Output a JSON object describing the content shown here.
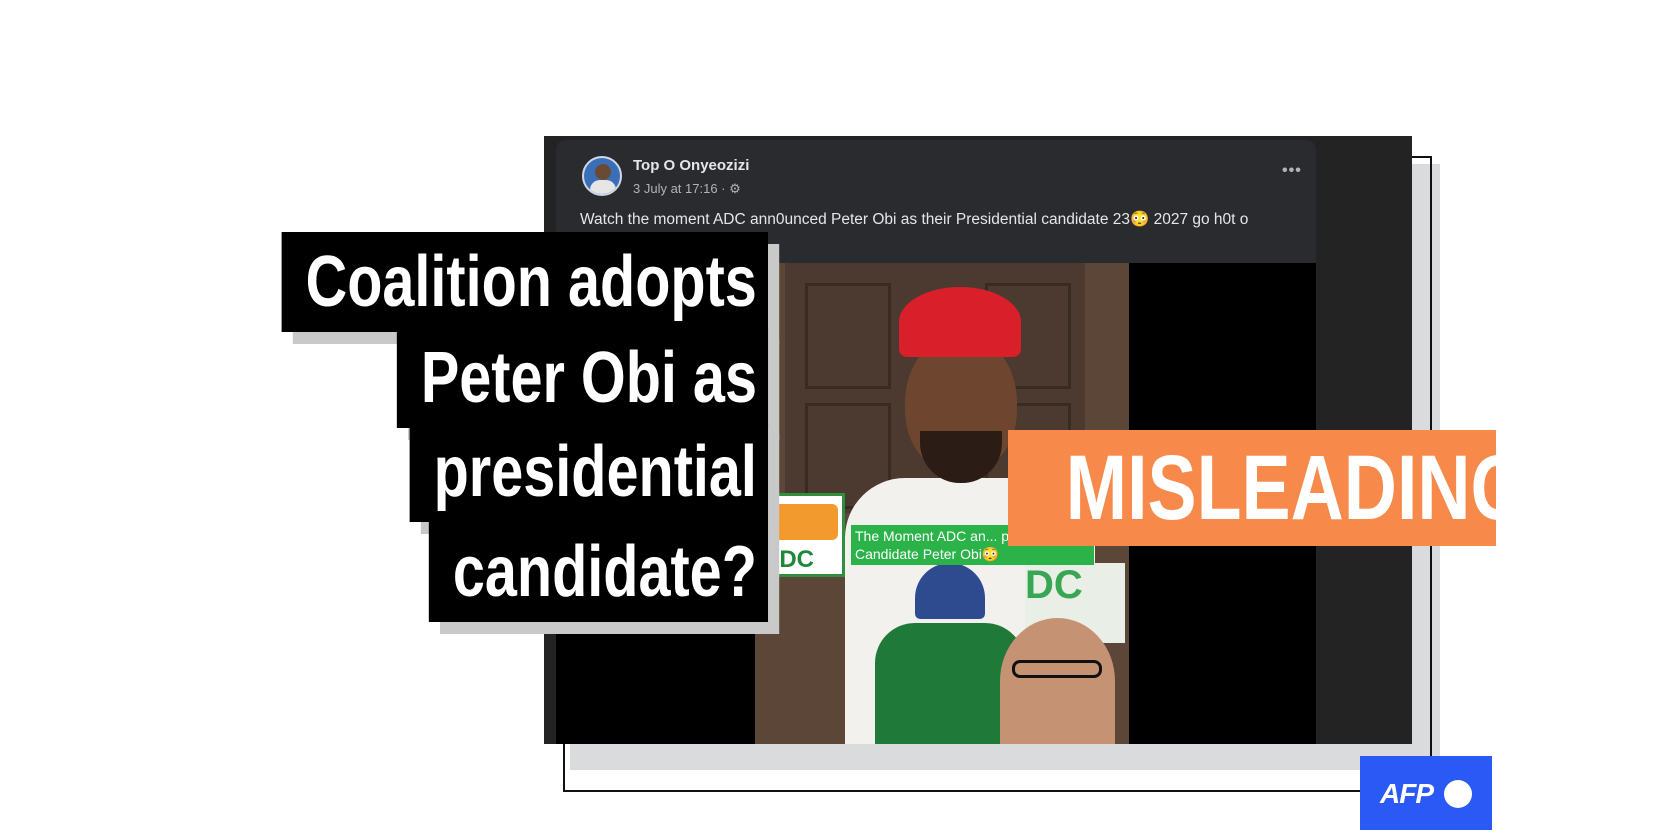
{
  "post": {
    "author": "Top O Onyeozizi",
    "timestamp": "3 July at 17:16 · ⚙",
    "more": "•••",
    "caption": "Watch the moment ADC ann0unced Peter Obi as their Presidential candidate 23😳  2027 go h0t o",
    "video_banner": "The Moment ADC an... presidential Candidate Peter Obi😳",
    "logo_text": "ADC",
    "backdrop_text": "DC"
  },
  "headline": {
    "lines": [
      "Coalition adopts",
      "Peter Obi as",
      "presidential",
      "candidate?"
    ]
  },
  "verdict": "MISLEADING",
  "brand": {
    "logo_text": "AFP",
    "color": "#2b59f5"
  },
  "colors": {
    "verdict": "#f7894a",
    "headline_bg": "#000000",
    "post_bg": "#232323"
  }
}
